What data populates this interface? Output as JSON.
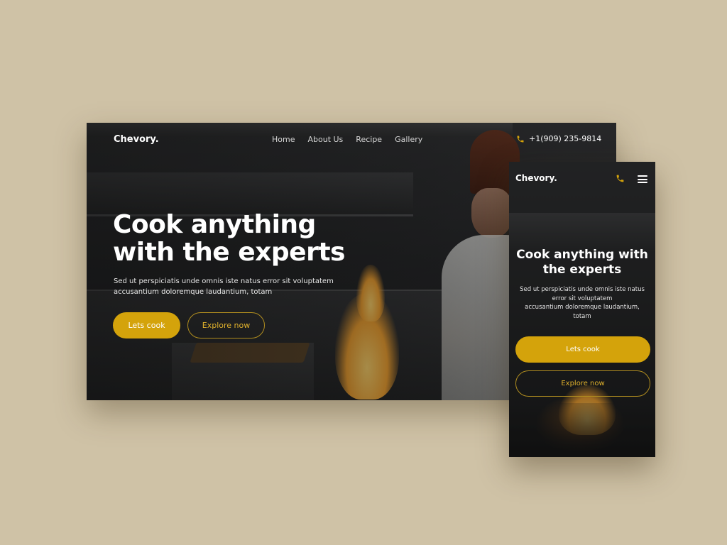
{
  "desktop": {
    "brand": "Chevory.",
    "nav": [
      "Home",
      "About Us",
      "Recipe",
      "Gallery"
    ],
    "phone": "+1(909) 235-9814",
    "hero": {
      "title_line1": "Cook anything",
      "title_line2": "with the experts",
      "subtitle_line1": "Sed ut perspiciatis unde omnis iste natus error sit voluptatem",
      "subtitle_line2": "accusantium doloremque laudantium, totam"
    },
    "buttons": {
      "primary": "Lets cook",
      "secondary": "Explore now"
    }
  },
  "mobile": {
    "brand": "Chevory.",
    "hero": {
      "title_line1": "Cook anything with",
      "title_line2": "the experts",
      "subtitle_line1": "Sed ut perspiciatis unde omnis iste natus",
      "subtitle_line2": "error sit voluptatem",
      "subtitle_line3": "accusantium doloremque laudantium,",
      "subtitle_line4": "totam"
    },
    "buttons": {
      "primary": "Lets cook",
      "secondary": "Explore now"
    }
  },
  "icons": {
    "phone": "phone-icon",
    "menu": "hamburger-menu-icon"
  },
  "colors": {
    "background": "#cfc2a6",
    "accent": "#d4a30b",
    "accent_text": "#e0b12c",
    "text": "#ffffff"
  }
}
